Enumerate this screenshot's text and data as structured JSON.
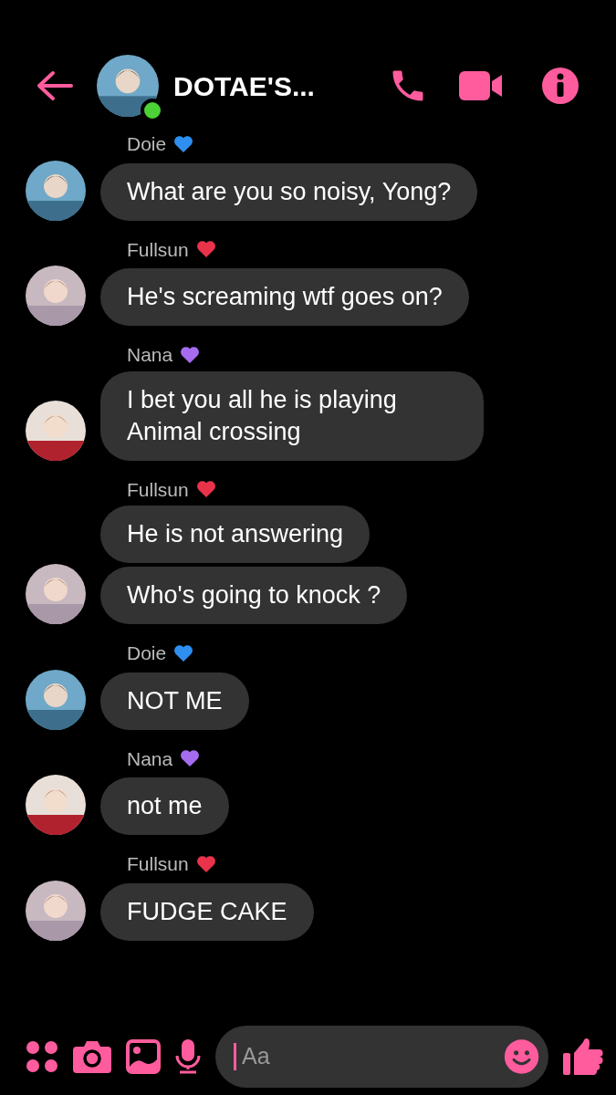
{
  "header": {
    "title": "DOTAE'S...",
    "online": true
  },
  "groups": [
    {
      "sender": "Doie",
      "color": "#2f8ff0",
      "messages": [
        "What are you so noisy, Yong?"
      ]
    },
    {
      "sender": "Fullsun",
      "color": "#e8334a",
      "messages": [
        "He's screaming wtf goes on?"
      ]
    },
    {
      "sender": "Nana",
      "color": "#a66cf0",
      "messages": [
        "I bet you all he is playing Animal crossing"
      ]
    },
    {
      "sender": "Fullsun",
      "color": "#e8334a",
      "messages": [
        "He is not answering",
        "Who's going to knock ?"
      ]
    },
    {
      "sender": "Doie",
      "color": "#2f8ff0",
      "messages": [
        "NOT ME"
      ]
    },
    {
      "sender": "Nana",
      "color": "#a66cf0",
      "messages": [
        "not me"
      ]
    },
    {
      "sender": "Fullsun",
      "color": "#e8334a",
      "messages": [
        "FUDGE CAKE"
      ]
    }
  ],
  "composer": {
    "placeholder": "Aa"
  }
}
